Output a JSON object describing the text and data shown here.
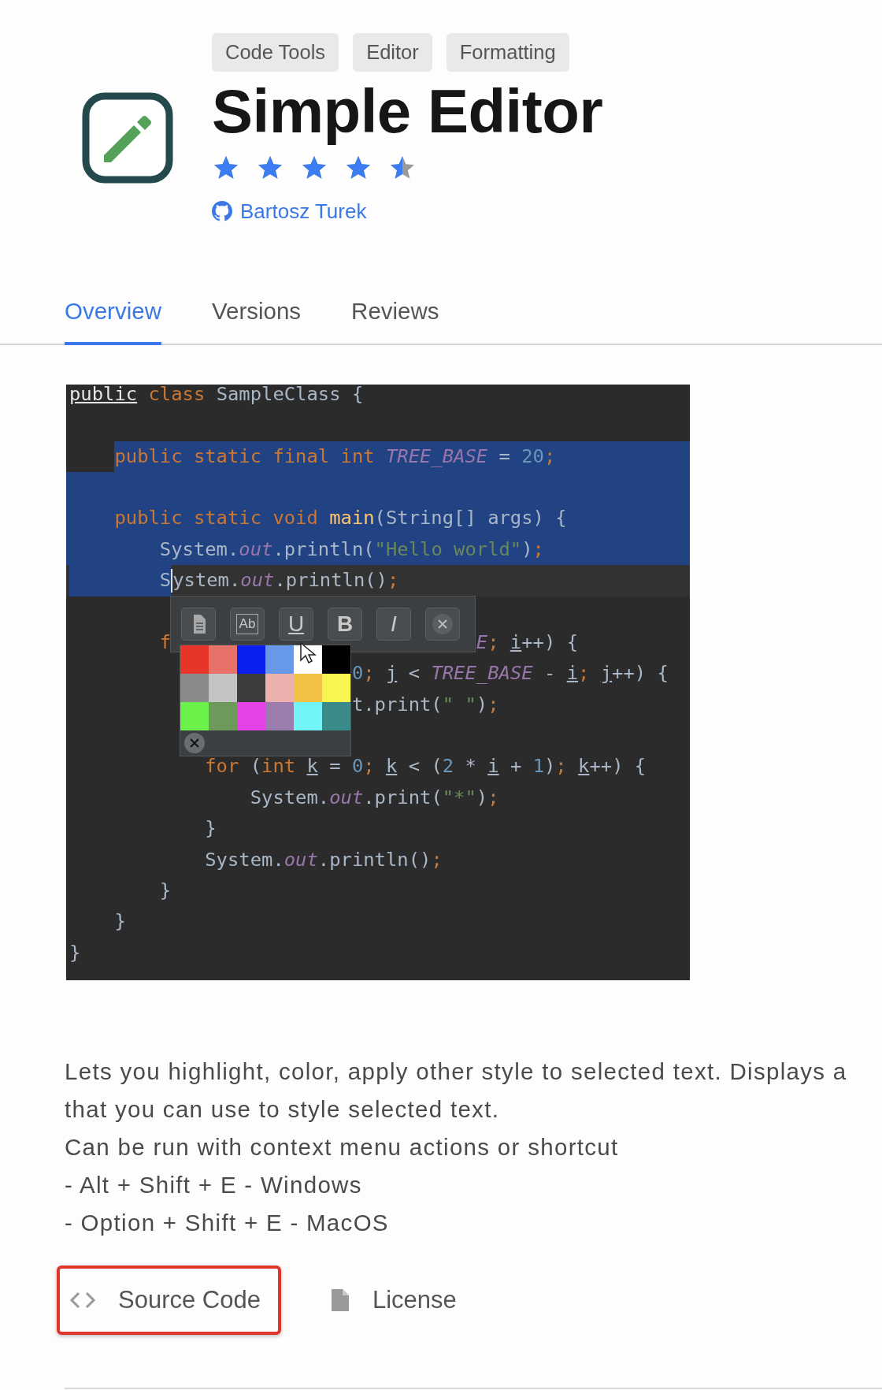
{
  "tags": [
    "Code Tools",
    "Editor",
    "Formatting"
  ],
  "title": "Simple Editor",
  "rating": {
    "stars": 4.5
  },
  "author": "Bartosz Turek",
  "tabs": [
    {
      "label": "Overview",
      "selected": true
    },
    {
      "label": "Versions",
      "selected": false
    },
    {
      "label": "Reviews",
      "selected": false
    }
  ],
  "screenshot": {
    "lines": [
      {
        "selected": false,
        "tokens": [
          {
            "kind": "declared",
            "text": "public"
          },
          {
            "kind": "kw",
            "text": " class"
          },
          {
            "kind": "plain",
            "text": " SampleClass {"
          }
        ]
      },
      {
        "selected": false
      },
      {
        "selected": true,
        "tokens": [
          {
            "kind": "anchor"
          },
          {
            "kind": "kw",
            "text": "public static final int "
          },
          {
            "kind": "constant",
            "text": "TREE_BASE"
          },
          {
            "kind": "plain",
            "text": " = "
          },
          {
            "kind": "num",
            "text": "20"
          },
          {
            "kind": "kw",
            "text": ";"
          }
        ]
      },
      {
        "selected": true
      },
      {
        "selected": true,
        "tokens": [
          {
            "kind": "kw",
            "text": "    public static void "
          },
          {
            "kind": "method",
            "text": "main"
          },
          {
            "kind": "plain",
            "text": "(String[] args) {"
          }
        ]
      },
      {
        "selected": true,
        "tokens": [
          {
            "kind": "plain",
            "text": "        System."
          },
          {
            "kind": "constant",
            "text": "out"
          },
          {
            "kind": "plain",
            "text": ".println("
          },
          {
            "kind": "string",
            "text": "\"Hello world\""
          },
          {
            "kind": "plain",
            "text": ")"
          },
          {
            "kind": "kw",
            "text": ";"
          }
        ]
      },
      {
        "selected": true,
        "tokens": [
          {
            "kind": "plain",
            "text": "        S"
          },
          {
            "kind": "caret"
          },
          {
            "kind": "plain",
            "text": "ystem."
          },
          {
            "kind": "constant",
            "text": "out"
          },
          {
            "kind": "plain",
            "text": ".println()"
          },
          {
            "kind": "kw",
            "text": ";"
          }
        ]
      },
      {
        "selected": false
      },
      {
        "selected": false,
        "tokens": [
          {
            "kind": "kw",
            "text": "        f"
          }
        ],
        "after": [
          {
            "kind": "constant",
            "text": "E"
          },
          {
            "kind": "kw",
            "text": "; "
          },
          {
            "kind": "var",
            "text": "i"
          },
          {
            "kind": "plain",
            "text": "++) {"
          }
        ]
      },
      {
        "selected": false,
        "after": [
          {
            "kind": "num",
            "text": "0"
          },
          {
            "kind": "kw",
            "text": "; "
          },
          {
            "kind": "var",
            "text": "j"
          },
          {
            "kind": "plain",
            "text": " < "
          },
          {
            "kind": "constant",
            "text": "TREE_BASE"
          },
          {
            "kind": "plain",
            "text": " - "
          },
          {
            "kind": "var",
            "text": "i"
          },
          {
            "kind": "kw",
            "text": "; "
          },
          {
            "kind": "var",
            "text": "j"
          },
          {
            "kind": "plain",
            "text": "++) {"
          }
        ]
      },
      {
        "selected": false,
        "after": [
          {
            "kind": "plain",
            "text": "t.print("
          },
          {
            "kind": "string",
            "text": "\" \""
          },
          {
            "kind": "plain",
            "text": ")"
          },
          {
            "kind": "kw",
            "text": ";"
          }
        ]
      },
      {
        "selected": false
      },
      {
        "selected": false,
        "tokens": [
          {
            "kind": "kw",
            "text": "            for"
          },
          {
            "kind": "plain",
            "text": " ("
          },
          {
            "kind": "kw",
            "text": "int "
          },
          {
            "kind": "var",
            "text": "k"
          },
          {
            "kind": "plain",
            "text": " = "
          },
          {
            "kind": "num",
            "text": "0"
          },
          {
            "kind": "kw",
            "text": "; "
          },
          {
            "kind": "var",
            "text": "k"
          },
          {
            "kind": "plain",
            "text": " < ("
          },
          {
            "kind": "num",
            "text": "2"
          },
          {
            "kind": "plain",
            "text": " * "
          },
          {
            "kind": "var",
            "text": "i"
          },
          {
            "kind": "plain",
            "text": " + "
          },
          {
            "kind": "num",
            "text": "1"
          },
          {
            "kind": "plain",
            "text": ")"
          },
          {
            "kind": "kw",
            "text": "; "
          },
          {
            "kind": "var",
            "text": "k"
          },
          {
            "kind": "plain",
            "text": "++) {"
          }
        ]
      },
      {
        "selected": false,
        "tokens": [
          {
            "kind": "plain",
            "text": "                System."
          },
          {
            "kind": "constant",
            "text": "out"
          },
          {
            "kind": "plain",
            "text": ".print("
          },
          {
            "kind": "string",
            "text": "\"*\""
          },
          {
            "kind": "plain",
            "text": ")"
          },
          {
            "kind": "kw",
            "text": ";"
          }
        ]
      },
      {
        "selected": false,
        "tokens": [
          {
            "kind": "plain",
            "text": "            }"
          }
        ]
      },
      {
        "selected": false,
        "tokens": [
          {
            "kind": "plain",
            "text": "            System."
          },
          {
            "kind": "constant",
            "text": "out"
          },
          {
            "kind": "plain",
            "text": ".println()"
          },
          {
            "kind": "kw",
            "text": ";"
          }
        ]
      },
      {
        "selected": false,
        "tokens": [
          {
            "kind": "plain",
            "text": "        }"
          }
        ]
      },
      {
        "selected": false,
        "tokens": [
          {
            "kind": "plain",
            "text": "    }"
          }
        ]
      },
      {
        "selected": false,
        "tokens": [
          {
            "kind": "plain",
            "text": "}"
          }
        ]
      }
    ],
    "popup": {
      "tools": [
        {
          "kind": "document"
        },
        {
          "kind": "text",
          "label": "Ab"
        },
        {
          "kind": "underline",
          "label": "U"
        },
        {
          "kind": "bold",
          "label": "B"
        },
        {
          "kind": "italic",
          "label": "I"
        },
        {
          "kind": "close"
        }
      ],
      "palette": [
        {
          "color": "#e8352a"
        },
        {
          "color": "#e8716a"
        },
        {
          "color": "#0a1ef0"
        },
        {
          "color": "#6898e8"
        },
        {
          "color": "#ffffff"
        },
        {
          "color": "#000000"
        },
        {
          "color": "#8a8a8a"
        },
        {
          "color": "#c4c4c4"
        },
        {
          "color": "#3c3c3c"
        },
        {
          "color": "#ecb0ae"
        },
        {
          "color": "#f2c246"
        },
        {
          "color": "#f8f450"
        },
        {
          "color": "#6cf04a"
        },
        {
          "color": "#6d9a5a"
        },
        {
          "color": "#e642e8"
        },
        {
          "color": "#9a7cae"
        },
        {
          "color": "#70f4f6"
        },
        {
          "color": "#3a8a8a"
        }
      ]
    }
  },
  "description": [
    "Lets you highlight, color, apply other style to selected text. Displays a",
    "that you can use to style selected text.",
    "Can be run with context menu actions or shortcut",
    "- Alt + Shift + E - Windows",
    "- Option + Shift + E - MacOS"
  ],
  "links": [
    {
      "kind": "source",
      "label": "Source Code",
      "highlighted": true
    },
    {
      "kind": "license",
      "label": "License",
      "highlighted": false
    }
  ]
}
